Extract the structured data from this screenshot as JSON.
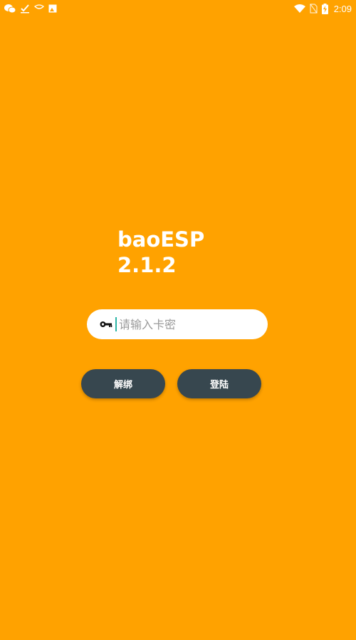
{
  "status_bar": {
    "left_icons": [
      "wechat-icon",
      "check-icon",
      "chat-bubble-icon",
      "image-icon"
    ],
    "right_icons": [
      "wifi-icon",
      "no-sim-icon",
      "battery-charging-icon"
    ],
    "time": "2:09"
  },
  "app": {
    "name": "baoESP",
    "version": "2.1.2"
  },
  "login": {
    "key_placeholder": "请输入卡密",
    "key_value": "",
    "unbind_label": "解绑",
    "login_label": "登陆"
  },
  "colors": {
    "background": "#FFA200",
    "button": "#37474F",
    "field": "#FFFFFF",
    "caret": "#2BB5A5"
  }
}
